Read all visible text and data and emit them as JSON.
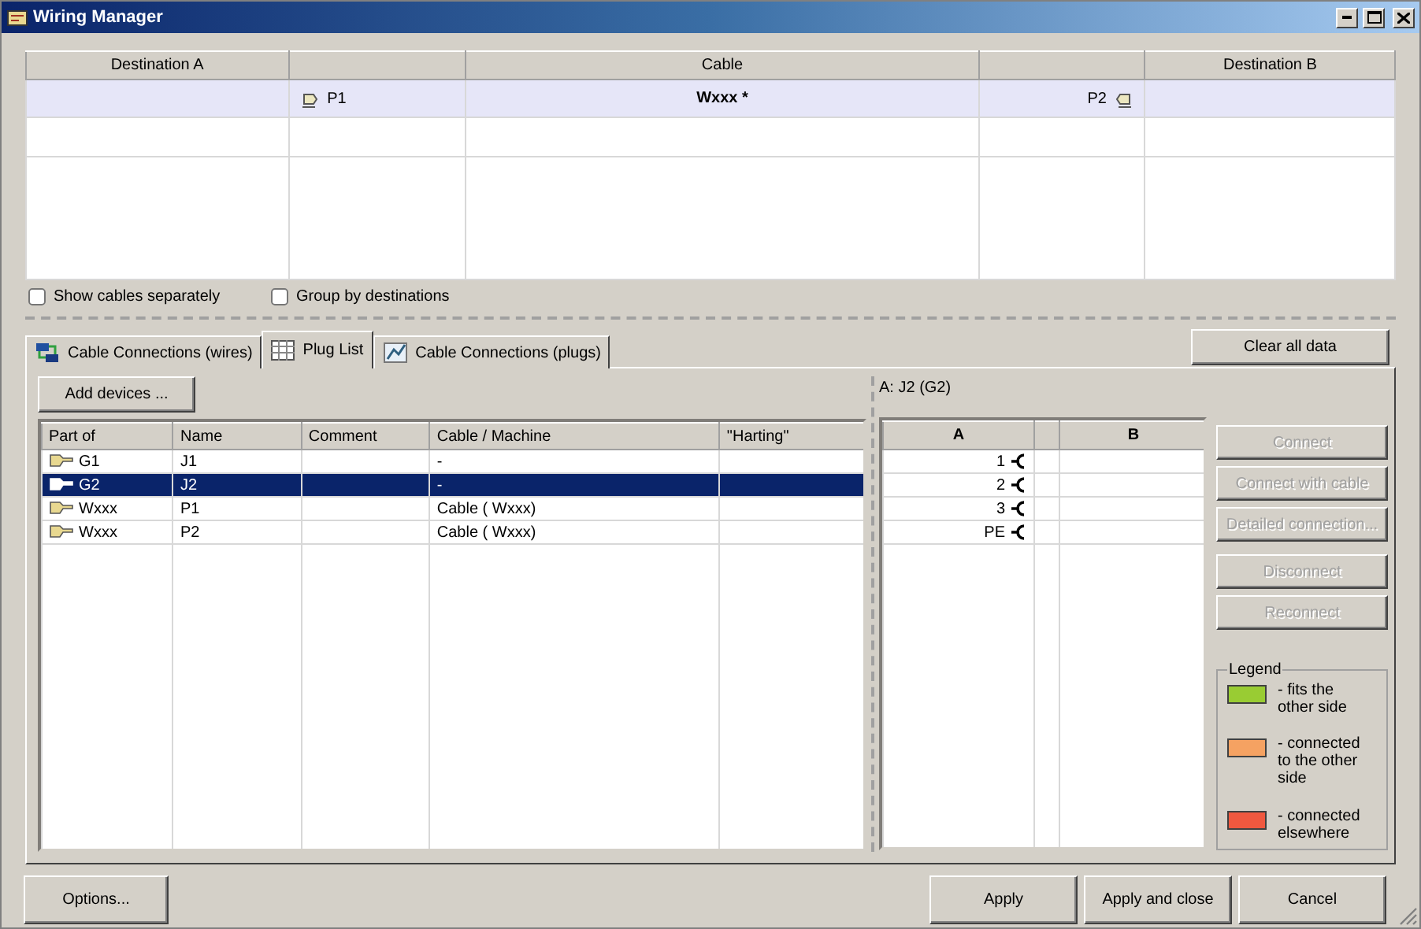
{
  "window": {
    "title": "Wiring Manager"
  },
  "connections": {
    "columns": [
      {
        "label": "Destination A"
      },
      {},
      {
        "label": "Cable"
      },
      {},
      {
        "label": "Destination B"
      }
    ],
    "rows": [
      {
        "plug_a": "P1",
        "cable": "Wxxx *",
        "plug_b": "P2",
        "selected": true
      }
    ]
  },
  "options": [
    {
      "label": "Show cables separately",
      "checked": false
    },
    {
      "label": "Group by destinations",
      "checked": false
    }
  ],
  "tabs": [
    {
      "label": "Cable Connections (wires)",
      "selected": false
    },
    {
      "label": "Plug List",
      "selected": true
    },
    {
      "label": "Cable Connections (plugs)",
      "selected": false
    }
  ],
  "clear_button": "Clear all data",
  "add_button": "Add devices ...",
  "plug_list": {
    "columns": [
      "Part of",
      "Name",
      "Comment",
      "Cable / Machine",
      "\"Harting\""
    ],
    "rows": [
      {
        "part_of": "G1",
        "name": "J1",
        "cable_machine": "-",
        "selected": false
      },
      {
        "part_of": "G2",
        "name": "J2",
        "cable_machine": "-",
        "selected": true
      },
      {
        "part_of": "Wxxx",
        "name": "P1",
        "cable_machine": "Cable ( Wxxx)",
        "selected": false
      },
      {
        "part_of": "Wxxx",
        "name": "P2",
        "cable_machine": "Cable ( Wxxx)",
        "selected": false
      }
    ]
  },
  "pin_panel": {
    "title": "A: J2 (G2)",
    "column_a": "A",
    "column_b": "B",
    "pins": [
      "1",
      "2",
      "3",
      "PE"
    ]
  },
  "actions": [
    {
      "label": "Connect",
      "disabled": true
    },
    {
      "label": "Connect with cable",
      "disabled": true
    },
    {
      "label": "Detailed connection...",
      "disabled": true
    },
    {
      "label": "Disconnect",
      "disabled": true
    },
    {
      "label": "Reconnect",
      "disabled": true
    }
  ],
  "legend": {
    "title": "Legend",
    "items": [
      {
        "label": "- fits the other side",
        "color": "#99cc33"
      },
      {
        "label": "- connected to the other side",
        "color": "#f5a262"
      },
      {
        "label": "- connected elsewhere",
        "color": "#f0583f"
      }
    ]
  },
  "footer": {
    "options": "Options...",
    "buttons": [
      "Apply",
      "Apply and close",
      "Cancel"
    ]
  }
}
